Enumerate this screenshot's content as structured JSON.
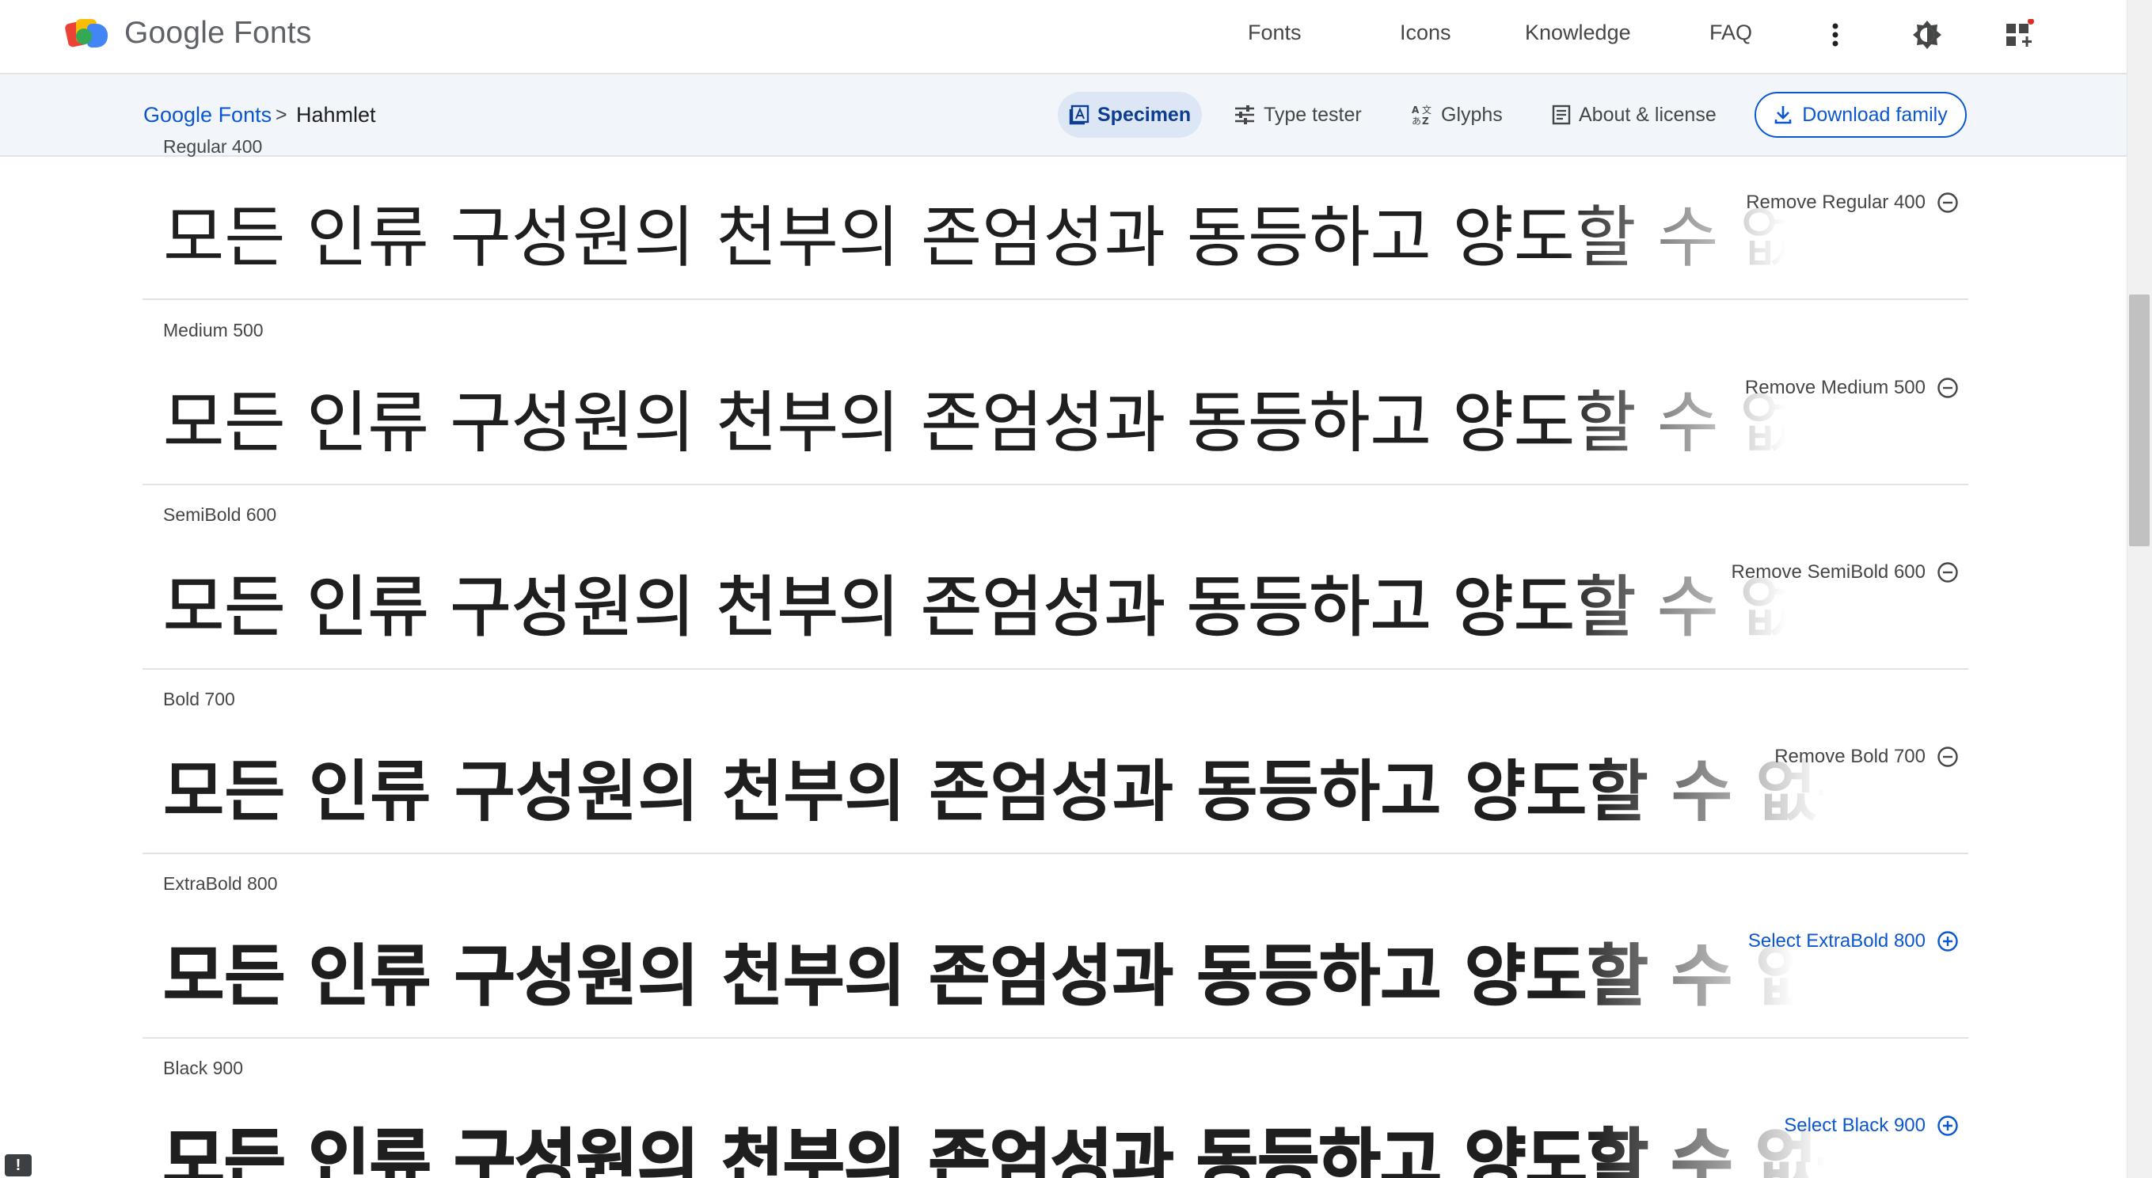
{
  "header": {
    "brand": "Google Fonts",
    "nav": [
      {
        "label": "Fonts"
      },
      {
        "label": "Icons"
      },
      {
        "label": "Knowledge"
      },
      {
        "label": "FAQ"
      }
    ],
    "icons": [
      "more-vert-icon",
      "theme-toggle-icon",
      "apps-icon"
    ],
    "colors": {
      "accent": "#0b57d0",
      "notification_dot": "#d93025"
    }
  },
  "subheader": {
    "breadcrumb": {
      "root": "Google Fonts",
      "separator": ">",
      "current": "Hahmlet"
    },
    "tabs": [
      {
        "label": "Specimen",
        "active": true
      },
      {
        "label": "Type tester",
        "active": false
      },
      {
        "label": "Glyphs",
        "active": false
      },
      {
        "label": "About & license",
        "active": false
      }
    ],
    "download_label": "Download family"
  },
  "styles": {
    "sample_text": "모든 인류 구성원의 천부의 존엄성과 동등하고 양도할 수 없는 권",
    "rows": [
      {
        "label": "Regular 400",
        "action": "Remove Regular 400",
        "selected": true
      },
      {
        "label": "Medium 500",
        "action": "Remove Medium 500",
        "selected": true
      },
      {
        "label": "SemiBold 600",
        "action": "Remove SemiBold 600",
        "selected": true
      },
      {
        "label": "Bold 700",
        "action": "Remove Bold 700",
        "selected": true
      },
      {
        "label": "ExtraBold 800",
        "action": "Select ExtraBold 800",
        "selected": false
      },
      {
        "label": "Black 900",
        "action": "Select Black 900",
        "selected": false
      }
    ]
  },
  "feedback_badge": "!"
}
